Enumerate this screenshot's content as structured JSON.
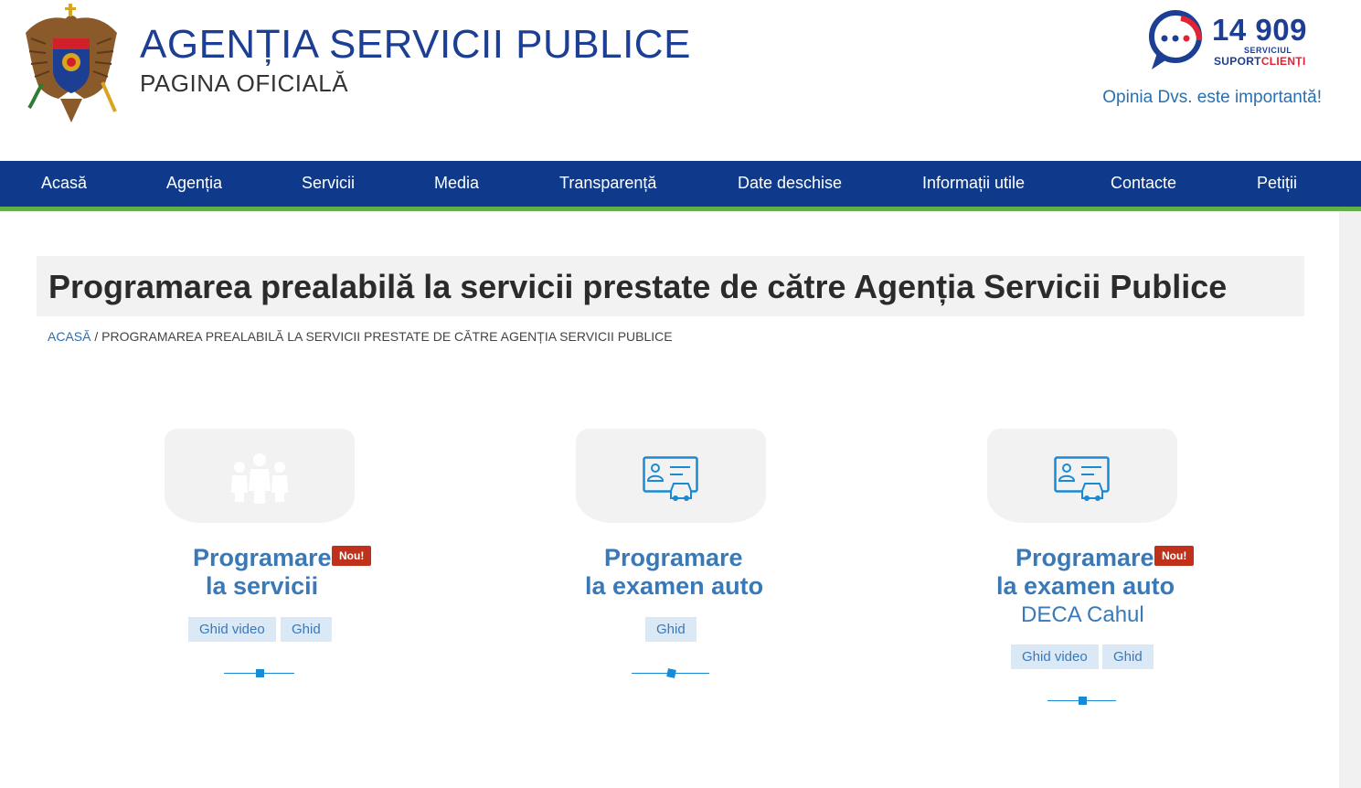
{
  "header": {
    "title": "AGENȚIA SERVICII PUBLICE",
    "subtitle": "PAGINA OFICIALĂ",
    "support_number": "14 909",
    "support_small": "SERVICIUL",
    "support_label_a": "SUPORT",
    "support_label_b": "CLIENȚI",
    "opinion_link": "Opinia Dvs. este importantă!"
  },
  "nav": {
    "items": [
      {
        "label": "Acasă"
      },
      {
        "label": "Agenția"
      },
      {
        "label": "Servicii"
      },
      {
        "label": "Media"
      },
      {
        "label": "Transparență"
      },
      {
        "label": "Date deschise"
      },
      {
        "label": "Informații utile"
      },
      {
        "label": "Contacte"
      },
      {
        "label": "Petiții"
      }
    ]
  },
  "page": {
    "title": "Programarea prealabilă la servicii prestate de către Agenția Servicii Publice",
    "breadcrumb_home": "ACASĂ",
    "breadcrumb_sep": " / ",
    "breadcrumb_current": "PROGRAMAREA PREALABILĂ LA SERVICII PRESTATE DE CĂTRE AGENȚIA SERVICII PUBLICE"
  },
  "cards": [
    {
      "title_line1": "Programare",
      "title_line2": "la servicii",
      "badge": "Nou!",
      "tags": [
        "Ghid video",
        "Ghid"
      ],
      "icon": "people-icon"
    },
    {
      "title_line1": "Programare",
      "title_line2": "la examen auto",
      "tags": [
        "Ghid"
      ],
      "icon": "driver-license-icon"
    },
    {
      "title_line1": "Programare",
      "title_line2": "la examen auto",
      "subtitle": "DECA Cahul",
      "badge": "Nou!",
      "tags": [
        "Ghid video",
        "Ghid"
      ],
      "icon": "driver-license-icon"
    }
  ],
  "colors": {
    "brand_blue": "#1c3f94",
    "nav_bg": "#0f3a8c",
    "nav_accent": "#63b04a",
    "link_blue": "#3a79b8",
    "badge_red": "#c0311b",
    "support_red": "#e32232"
  }
}
